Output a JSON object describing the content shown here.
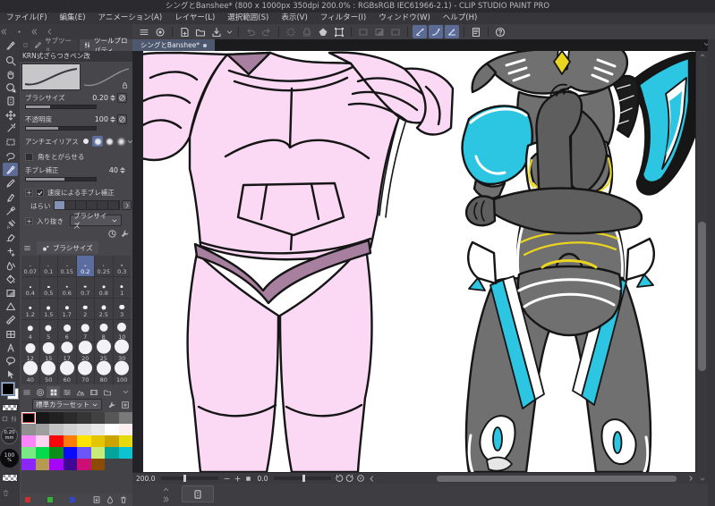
{
  "window": {
    "title": "シングとBanshee* (800 x 1000px 350dpi 200.0% : RGBsRGB IEC61966-2.1)  - CLIP STUDIO PAINT PRO"
  },
  "menu": {
    "items": [
      "ファイル(F)",
      "編集(E)",
      "アニメーション(A)",
      "レイヤー(L)",
      "選択範囲(S)",
      "表示(V)",
      "フィルター(I)",
      "ウィンドウ(W)",
      "ヘルプ(H)"
    ]
  },
  "dock_controls": [
    {
      "name": "collapse-tool-dock",
      "icon": "dblchevl"
    },
    {
      "name": "dock-handle",
      "icon": "dot"
    },
    {
      "name": "collapse-subtool-dock",
      "icon": "dblchevl"
    },
    {
      "name": "collapse-property-dock",
      "icon": "chevl"
    }
  ],
  "command_bar": {
    "items": [
      {
        "name": "main-menu",
        "icon": "menu"
      },
      {
        "name": "open-clip-studio",
        "icon": "clip"
      },
      {
        "sep": true
      },
      {
        "name": "new-file",
        "icon": "newdoc"
      },
      {
        "name": "open-file",
        "icon": "open"
      },
      {
        "name": "save",
        "icon": "export"
      },
      {
        "name": "save-options",
        "icon": "chevd",
        "narrow": true
      },
      {
        "sep": true
      },
      {
        "name": "undo",
        "icon": "undo",
        "disabled": true
      },
      {
        "name": "redo",
        "icon": "redo",
        "disabled": true
      },
      {
        "sep": true
      },
      {
        "name": "deselect",
        "icon": "burst",
        "disabled": true
      },
      {
        "name": "reselect",
        "icon": "stamp",
        "disabled": true
      },
      {
        "name": "invert-selection",
        "icon": "fillpoly"
      },
      {
        "name": "scale-rotate",
        "icon": "transform"
      },
      {
        "sep": true
      },
      {
        "name": "fill-selection",
        "icon": "rect",
        "disabled": true
      },
      {
        "name": "new-selection-layer",
        "icon": "rectsplit",
        "disabled": true
      },
      {
        "name": "selection-border",
        "icon": "rect",
        "disabled": true
      },
      {
        "sep": true
      },
      {
        "name": "snap-to-ruler",
        "icon": "snap1",
        "active": true
      },
      {
        "name": "snap-to-special-ruler",
        "icon": "snap2",
        "active": true
      },
      {
        "name": "snap-to-grid",
        "icon": "snap3",
        "active": true
      },
      {
        "sep": true
      },
      {
        "name": "open-material-panel",
        "icon": "page"
      },
      {
        "sep": true
      },
      {
        "name": "help",
        "icon": "help"
      }
    ]
  },
  "tool_strip": {
    "tools": [
      {
        "name": "current-pen",
        "icon": "pen"
      },
      {
        "name": "zoom",
        "icon": "zoom"
      },
      {
        "name": "hand",
        "icon": "hand"
      },
      {
        "name": "rotate-canvas",
        "icon": "rotate"
      },
      {
        "name": "operation",
        "icon": "operation"
      },
      {
        "name": "move-layer",
        "icon": "move"
      },
      {
        "name": "auto-select",
        "icon": "autoselect"
      },
      {
        "name": "marquee",
        "icon": "marquee"
      },
      {
        "name": "lasso",
        "icon": "lasso"
      },
      {
        "name": "pen",
        "icon": "pen",
        "active": true
      },
      {
        "name": "pencil",
        "icon": "pencil"
      },
      {
        "name": "marker",
        "icon": "marker"
      },
      {
        "name": "eyedropper",
        "icon": "eyedropper"
      },
      {
        "name": "airbrush",
        "icon": "airbrush"
      },
      {
        "name": "eraser",
        "icon": "eraser"
      },
      {
        "name": "decoration",
        "icon": "decoration"
      },
      {
        "name": "blend",
        "icon": "blend"
      },
      {
        "name": "fill",
        "icon": "fill"
      },
      {
        "name": "gradient",
        "icon": "gradient"
      },
      {
        "name": "figure",
        "icon": "figure"
      },
      {
        "name": "ruler",
        "icon": "ruler"
      },
      {
        "name": "frame-border",
        "icon": "frame"
      },
      {
        "name": "text",
        "icon": "text"
      },
      {
        "name": "balloon",
        "icon": "balloon"
      },
      {
        "name": "select-pointer",
        "icon": "selpointer"
      }
    ]
  },
  "tool_property": {
    "tab_subtool": "サブツール",
    "tab_toolprop": "ツールプロパティ",
    "brush_name": "KRN式ざらつきペン改",
    "brush_size_label": "ブラシサイズ",
    "brush_size_value": "0.20",
    "opacity_label": "不透明度",
    "opacity_value": "100",
    "antialias_label": "アンチエイリアス",
    "corner_label": "角をとがらせる",
    "stabilize_label": "手ブレ補正",
    "stabilize_value": "40",
    "speed_stabilize_label": "速度による手ブレ補正",
    "harai_label": "はらい",
    "inout_label": "入り抜き",
    "inout_value": "ブラシサイズ"
  },
  "brush_size_panel": {
    "title": "ブラシサイズ",
    "sizes": [
      "0.07",
      "0.1",
      "0.15",
      "0.2",
      "0.25",
      "0.3",
      "0.4",
      "0.5",
      "0.6",
      "0.7",
      "0.8",
      "1",
      "1.2",
      "1.5",
      "1.7",
      "2",
      "2.5",
      "3",
      "4",
      "5",
      "6",
      "7",
      "8",
      "10",
      "12",
      "15",
      "17",
      "20",
      "25",
      "30",
      "40",
      "50",
      "60",
      "70",
      "80",
      "100"
    ],
    "selected": "0.2"
  },
  "color_panel": {
    "tabs": [
      {
        "name": "palette-menu",
        "icon": "menu"
      },
      {
        "name": "color-wheel",
        "icon": "wheel"
      },
      {
        "name": "color-set",
        "icon": "palette",
        "active": true
      },
      {
        "name": "color-sliders",
        "icon": "sliders"
      },
      {
        "name": "approximate-color",
        "icon": "mountain"
      },
      {
        "name": "intermediate-color",
        "icon": "film"
      },
      {
        "name": "color-history",
        "icon": "folder"
      }
    ],
    "set_name": "標準カラーセット",
    "rows": [
      [
        "#000000",
        "#171717",
        "#212121",
        "#2b2b2b",
        "#353535",
        "#414141",
        "#575757",
        "#7a7a7a"
      ],
      [
        "#8f8f8f",
        "#9e9e9e",
        "#c3c3c3",
        "#d2d2d2",
        "#dcdcdc",
        "#e8e8e8",
        "#ffffff",
        "#fbefef"
      ],
      [
        "#fb86fb",
        "#fdd3f0",
        "#f80708",
        "#fd7d08",
        "#ffe501",
        "#e5c501",
        "#cca400",
        "#e4da0e"
      ],
      [
        "#79e985",
        "#05da4c",
        "#0c8e18",
        "#0a0afd",
        "#6b56fa",
        "#c9ec79",
        "#05a49b",
        "#0cc3d1"
      ],
      [
        "#8b27fd",
        "#b49b51",
        "#a704fb",
        "#3f0793",
        "#cb0f76",
        "#8c4b05",
        null,
        null
      ]
    ],
    "selected": [
      0,
      0
    ],
    "footer_colors": [
      "#c83232",
      "#32b432",
      "#3246c8"
    ],
    "footer_icons": [
      {
        "name": "import-color-set",
        "icon": "import"
      },
      {
        "name": "register-color",
        "icon": "droplet"
      },
      {
        "name": "delete-color",
        "icon": "trash"
      }
    ]
  },
  "color_controls": {
    "main_color": "#000000",
    "sub_color": "#ffffff",
    "brush_width_value": "0.20",
    "brush_width_unit": "mm",
    "opacity_value": "100",
    "opacity_unit": "%"
  },
  "canvas": {
    "tab_label": "シングとBanshee*"
  },
  "status_bar": {
    "zoom_value": "200.0",
    "rotation_value": "0.0",
    "controls": [
      "zoom-out",
      "zoom-in",
      "fit-to-screen",
      "rotate-left",
      "rotate-right",
      "reset-rotation",
      "back"
    ]
  },
  "artwork": {
    "colors": {
      "page": "#ffffff",
      "pink": "#fbd9f4",
      "mauve": "#a8809f",
      "gray": "#707070",
      "armgray": "#5e5e5e",
      "cyan": "#2cc5e2",
      "yellow": "#e9d41f",
      "white": "#ffffff",
      "ink": "#151515"
    }
  }
}
